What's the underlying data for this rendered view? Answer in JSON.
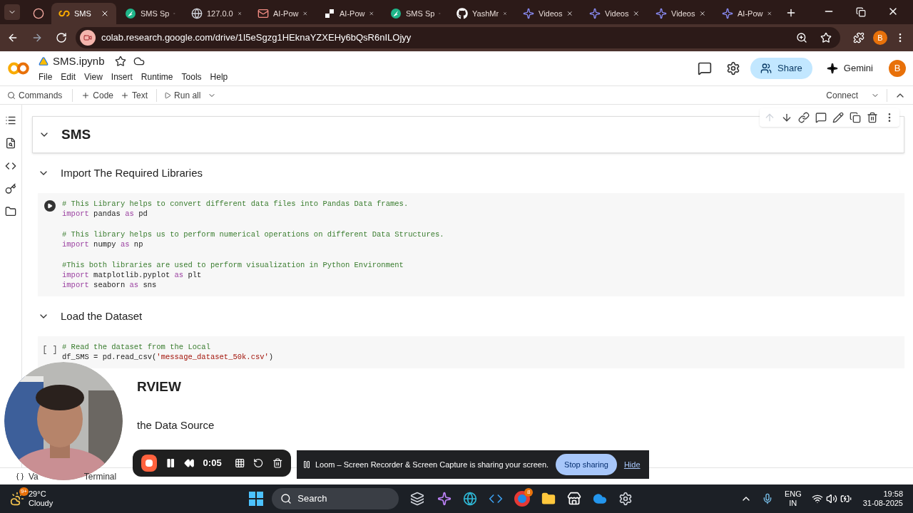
{
  "browser": {
    "tabs": [
      {
        "kind": "record",
        "selected": false
      },
      {
        "kind": "colab",
        "title": "SMS",
        "selected": true
      },
      {
        "kind": "streamlit",
        "title": "SMS Sp",
        "selected": false
      },
      {
        "kind": "globe",
        "title": "127.0.0",
        "selected": false
      },
      {
        "kind": "mail",
        "title": "AI-Pow",
        "selected": false
      },
      {
        "kind": "ai",
        "title": "AI-Pow",
        "selected": false
      },
      {
        "kind": "streamlit",
        "title": "SMS Sp",
        "selected": false
      },
      {
        "kind": "github",
        "title": "YashMr",
        "selected": false
      },
      {
        "kind": "videos",
        "title": "Videos",
        "selected": false
      },
      {
        "kind": "videos",
        "title": "Videos",
        "selected": false
      },
      {
        "kind": "videos",
        "title": "Videos",
        "selected": false
      },
      {
        "kind": "videos",
        "title": "AI-Pow",
        "selected": false
      }
    ],
    "url": "colab.research.google.com/drive/1I5eSgzg1HEknaYZXEHy6bQsR6nILOjyy",
    "profile": "B"
  },
  "notebook": {
    "title": "SMS.ipynb",
    "menu": [
      "File",
      "Edit",
      "View",
      "Insert",
      "Runtime",
      "Tools",
      "Help"
    ],
    "share": "Share",
    "gemini": "Gemini",
    "avatar": "B",
    "toolbar": {
      "commands": "Commands",
      "code": "Code",
      "text": "Text",
      "run_all": "Run all",
      "connect": "Connect"
    }
  },
  "cells": [
    {
      "kind": "title",
      "text": "SMS",
      "expanded": true,
      "selected": true
    },
    {
      "kind": "section",
      "text": "Import The Required Libraries",
      "expanded": true,
      "selected": false
    },
    {
      "kind": "code",
      "blocks": [
        [
          [
            {
              "kind": "comment",
              "text": "# This Library helps to convert different data files into Pandas Data frames."
            }
          ],
          [
            {
              "kind": "keyword",
              "text": "import"
            },
            {
              "kind": "plain",
              "text": " pandas "
            },
            {
              "kind": "keyword",
              "text": "as"
            },
            {
              "kind": "plain",
              "text": " pd"
            }
          ]
        ],
        [
          [
            {
              "kind": "comment",
              "text": "# This library helps us to perform numerical operations on different Data Structures."
            }
          ],
          [
            {
              "kind": "keyword",
              "text": "import"
            },
            {
              "kind": "plain",
              "text": " numpy "
            },
            {
              "kind": "keyword",
              "text": "as"
            },
            {
              "kind": "plain",
              "text": " np"
            }
          ]
        ],
        [
          [
            {
              "kind": "comment",
              "text": "#This both libraries are used to perform visualization in Python Environment"
            }
          ],
          [
            {
              "kind": "keyword",
              "text": "import"
            },
            {
              "kind": "plain",
              "text": " matplotlib.pyplot "
            },
            {
              "kind": "keyword",
              "text": "as"
            },
            {
              "kind": "plain",
              "text": " plt"
            }
          ],
          [
            {
              "kind": "keyword",
              "text": "import"
            },
            {
              "kind": "plain",
              "text": " seaborn "
            },
            {
              "kind": "keyword",
              "text": "as"
            },
            {
              "kind": "plain",
              "text": " sns"
            }
          ]
        ]
      ]
    },
    {
      "kind": "section",
      "text": "Load the Dataset",
      "expanded": true,
      "selected": false
    },
    {
      "kind": "code",
      "bracket": "[ ]",
      "blocks": [
        [
          [
            {
              "kind": "comment",
              "text": "# Read the dataset from the Local"
            }
          ],
          [
            {
              "kind": "plain",
              "text": "df_SMS = pd.read_csv("
            },
            {
              "kind": "string",
              "text": "'message_dataset_50k.csv'"
            },
            {
              "kind": "plain",
              "text": ")"
            }
          ]
        ]
      ]
    },
    {
      "kind": "title",
      "text": "RVIEW"
    },
    {
      "kind": "section",
      "text": "the Data Source"
    }
  ],
  "status_bar": {
    "variables": "Va",
    "terminal": "Terminal"
  },
  "loom": {
    "time": "0:05",
    "message": "Loom – Screen Recorder & Screen Capture is sharing your screen.",
    "stop": "Stop sharing",
    "hide": "Hide"
  },
  "taskbar": {
    "weather_badge": "9+",
    "temperature": "29°C",
    "condition": "Cloudy",
    "search": "Search",
    "chrome_badge": "8",
    "language": "ENG",
    "region": "IN",
    "time": "19:58",
    "date": "31-08-2025"
  }
}
